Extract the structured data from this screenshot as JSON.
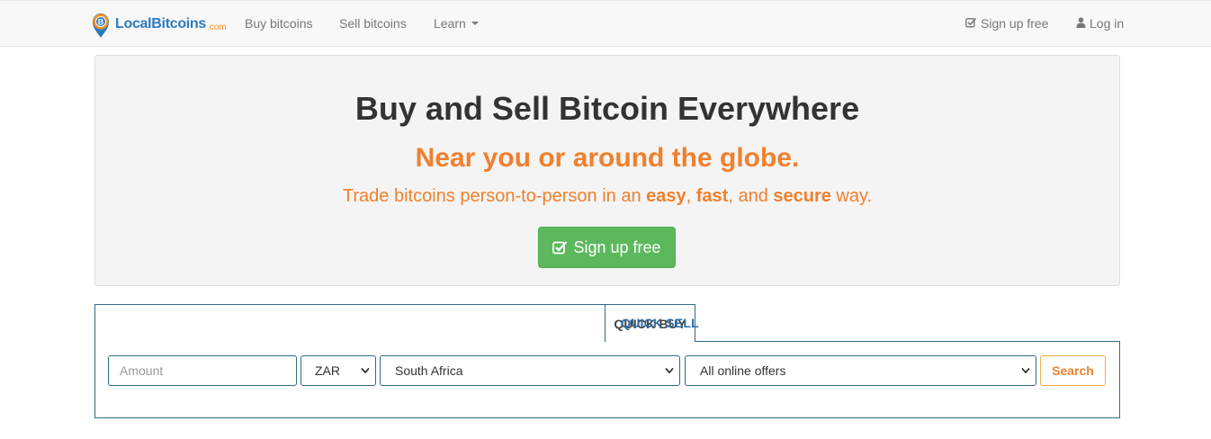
{
  "brand": {
    "name": "LocalBitcoins",
    "suffix": ".com",
    "icon": "bitcoin-pin-icon"
  },
  "nav": {
    "buy": "Buy bitcoins",
    "sell": "Sell bitcoins",
    "learn": "Learn",
    "signup": "Sign up free",
    "login": "Log in"
  },
  "hero": {
    "title": "Buy and Sell Bitcoin Everywhere",
    "subtitle": "Near you or around the globe.",
    "tagline_prefix": "Trade bitcoins person-to-person in an ",
    "tagline_easy": "easy",
    "tagline_sep1": ", ",
    "tagline_fast": "fast",
    "tagline_sep2": ", and ",
    "tagline_secure": "secure",
    "tagline_suffix": " way.",
    "cta": "Sign up free"
  },
  "quick": {
    "tabs": [
      "QUICK BUY",
      "QUICK SELL"
    ],
    "active_tab": "QUICK BUY",
    "amount_placeholder": "Amount",
    "currency": "ZAR",
    "country": "South Africa",
    "offers": "All online offers",
    "search": "Search"
  },
  "colors": {
    "accent_orange": "#f0802d",
    "success_green": "#5cb85c",
    "border_blue": "#2e6b8a",
    "link_blue": "#2d6ea6"
  }
}
